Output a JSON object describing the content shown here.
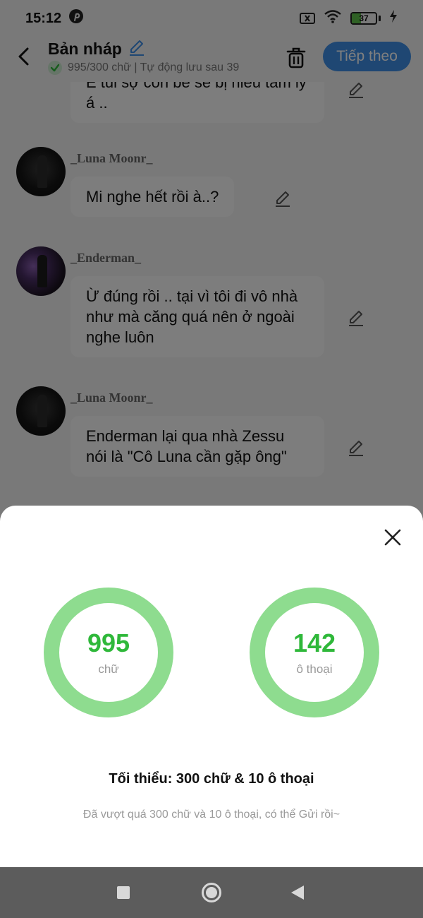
{
  "status_bar": {
    "time": "15:12",
    "battery": "37",
    "battery_level": 0.37,
    "icons": [
      "pinterest-icon",
      "sim-x-icon",
      "wifi-icon",
      "battery-icon",
      "charging-icon"
    ]
  },
  "header": {
    "title": "Bản nháp",
    "subtitle": "995/300 chữ | Tự động lưu sau 39",
    "next_label": "Tiếp theo",
    "accent": "#3e8ee7"
  },
  "messages": [
    {
      "author": "",
      "text": "E tui sợ con bé sẽ bị hiểu tâm lý á .."
    },
    {
      "author": "_Luna Moonr_",
      "text": "Mi nghe hết rồi à..?"
    },
    {
      "author": "_Enderman_",
      "text": "Ừ đúng rồi .. tại vì tôi đi vô nhà như mà căng quá nên ở ngoài nghe luôn"
    },
    {
      "author": "_Luna Moonr_",
      "text": "Enderman lại qua nhà Zessu nói là \"Cô Luna cần gặp ông\""
    }
  ],
  "sheet": {
    "words_value": "995",
    "words_unit": "chữ",
    "dialogs_value": "142",
    "dialogs_unit": "ô thoại",
    "minimum": "Tối thiểu: 300 chữ & 10 ô thoại",
    "hint": "Đã vượt quá 300 chữ và 10 ô thoại, có thể Gửi rồi~",
    "ring_color": "#8edc8f",
    "value_color": "#2fb83a"
  }
}
